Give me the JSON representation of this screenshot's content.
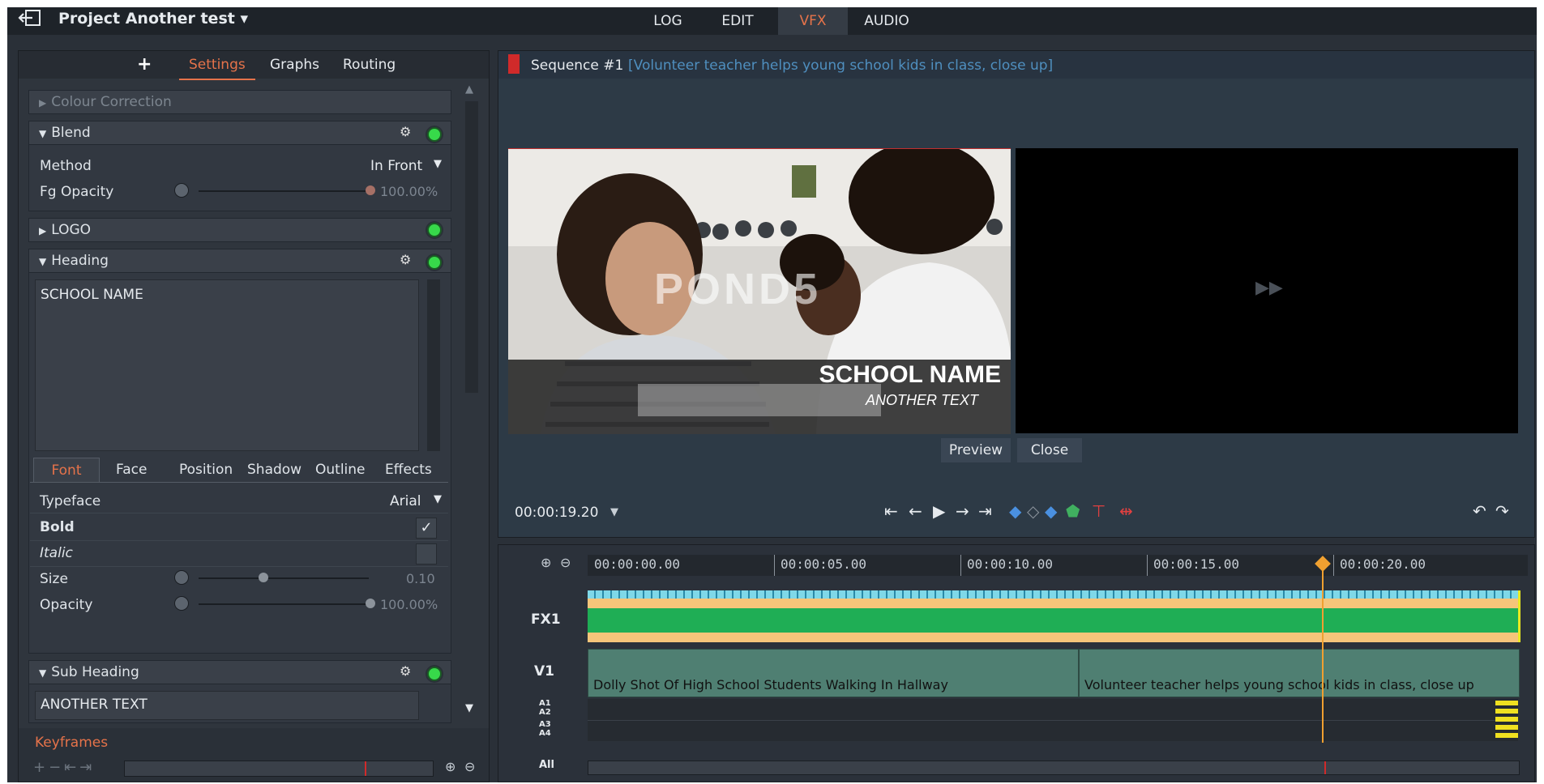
{
  "header": {
    "project_title": "Project Another test ▾",
    "tabs": [
      {
        "label": "LOG"
      },
      {
        "label": "EDIT"
      },
      {
        "label": "VFX"
      },
      {
        "label": "AUDIO"
      }
    ],
    "active_tab": "VFX"
  },
  "left_panel": {
    "tabs": [
      "Settings",
      "Graphs",
      "Routing"
    ],
    "active_tab": "Settings",
    "sections": {
      "colour_correction": "Colour Correction",
      "blend": {
        "title": "Blend",
        "method_label": "Method",
        "method_value": "In Front",
        "fg_opacity_label": "Fg Opacity",
        "fg_opacity_value": "100.00%",
        "fg_opacity_level": 1.0
      },
      "logo": "LOGO",
      "heading": {
        "title": "Heading",
        "text": "SCHOOL NAME"
      },
      "font_tabs": [
        "Font",
        "Face",
        "Position",
        "Shadow",
        "Outline",
        "Effects"
      ],
      "active_font_tab": "Font",
      "typeface_label": "Typeface",
      "typeface_value": "Arial",
      "bold_label": "Bold",
      "bold_checked": "✓",
      "italic_label": "Italic",
      "size_label": "Size",
      "size_value": "0.10",
      "opacity_label": "Opacity",
      "opacity_value": "100.00%",
      "sub_heading": {
        "title": "Sub Heading",
        "text": "ANOTHER TEXT"
      }
    },
    "keyframes_label": "Keyframes"
  },
  "viewer": {
    "sequence_title": "Sequence #1",
    "clip_name": "[Volunteer teacher helps young school kids in class, close up]",
    "watermark": "POND5",
    "overlay_title": "SCHOOL NAME",
    "overlay_subtitle": "ANOTHER TEXT",
    "preview_button": "Preview",
    "close_button": "Close",
    "timecode": "00:00:19.20"
  },
  "timeline": {
    "ruler": [
      "00:00:00.00",
      "00:00:05.00",
      "00:00:10.00",
      "00:00:15.00",
      "00:00:20.00"
    ],
    "tracks": {
      "fx1": "FX1",
      "v1": "V1",
      "a1": "A1",
      "a2": "A2",
      "a3": "A3",
      "a4": "A4",
      "all": "All"
    },
    "clips": [
      "Dolly Shot Of High School Students Walking In Hallway",
      "Volunteer teacher helps young school kids in class, close up"
    ],
    "playhead_time": "00:00:19.20"
  },
  "colors": {
    "accent": "#e6734a",
    "led_green": "#37d94a",
    "fx_green": "#1fae55",
    "fx_orange": "#f5c57a",
    "clip_teal": "#4f7f72",
    "playhead": "#f0a030",
    "link_blue": "#4f8fbf"
  }
}
